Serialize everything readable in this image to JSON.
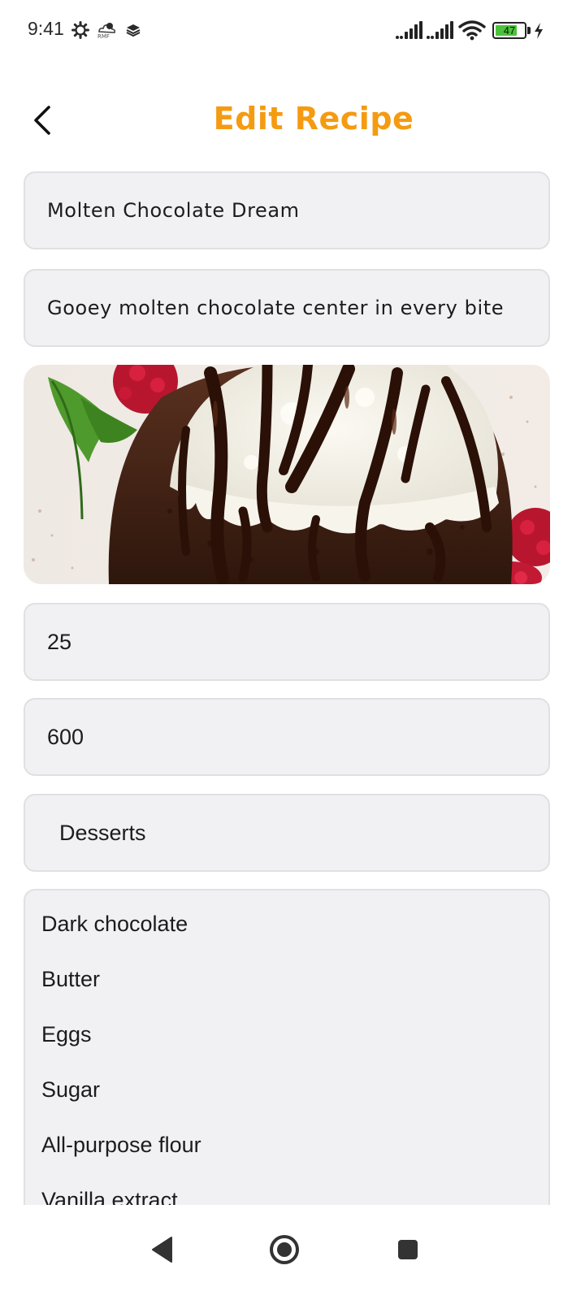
{
  "status_bar": {
    "time": "9:41",
    "battery_level": "47",
    "icons": [
      "gear-icon",
      "cloud-icon",
      "layers-icon",
      "signal-icon",
      "signal-icon",
      "wifi-icon",
      "battery-icon",
      "charging-icon"
    ]
  },
  "header": {
    "title": "Edit Recipe",
    "back_icon": "chevron-left-icon"
  },
  "form": {
    "name": "Molten Chocolate Dream",
    "description": "Gooey molten chocolate center in every bite",
    "image_alt": "Chocolate lava cake topped with vanilla ice cream and chocolate drizzle",
    "time_value": "25",
    "calories_value": "600",
    "category": "Desserts",
    "ingredients": [
      "Dark chocolate",
      "Butter",
      "Eggs",
      "Sugar",
      "All-purpose flour",
      "Vanilla extract"
    ]
  },
  "nav": {
    "icons": [
      "back-triangle-icon",
      "home-circle-icon",
      "recents-square-icon"
    ]
  },
  "colors": {
    "accent": "#f49b12",
    "field_bg": "#f1f1f3",
    "field_border": "#e0e0e4",
    "text": "#1c1c1e"
  }
}
